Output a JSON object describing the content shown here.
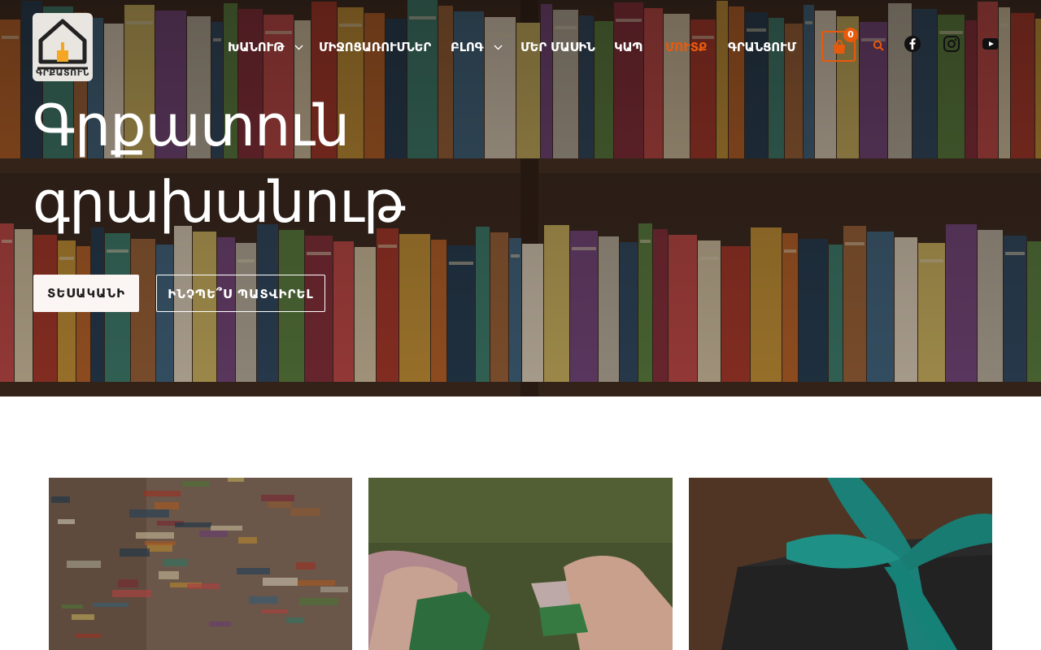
{
  "logo": {
    "text": "ԳՐՔԱՏՈՒՆ"
  },
  "nav": {
    "items": [
      {
        "label": "ԽԱՆՈՒԹ",
        "has_dropdown": true
      },
      {
        "label": "ՄԻՋՈՑԱՌՈՒՄՆԵՐ",
        "has_dropdown": false
      },
      {
        "label": "ԲԼՈԳ",
        "has_dropdown": true
      },
      {
        "label": "ՄԵՐ ՄԱՍԻՆ",
        "has_dropdown": false
      },
      {
        "label": "ԿԱՊ",
        "has_dropdown": false
      },
      {
        "label": "ՄՈՒՏՔ",
        "has_dropdown": false,
        "active": true
      },
      {
        "label": "ԳՐԱՆՑՈՒՄ",
        "has_dropdown": false
      }
    ]
  },
  "cart": {
    "count": "0",
    "icon": "shopping-bag-icon"
  },
  "search": {
    "icon": "search-icon"
  },
  "social": [
    {
      "name": "facebook",
      "icon": "facebook-icon"
    },
    {
      "name": "instagram",
      "icon": "instagram-icon"
    },
    {
      "name": "youtube",
      "icon": "youtube-icon"
    }
  ],
  "hero": {
    "title_line1": "Գրքատուն",
    "title_line2": "գրախանութ",
    "primary_button": "ՏԵՍԱԿԱՆԻ",
    "secondary_button": "ԻՆՉՊԵ՞Ս ՊԱՏՎԻՐԵԼ"
  },
  "cards": [
    {
      "image": "books-stack"
    },
    {
      "image": "puzzle-pieces"
    },
    {
      "image": "gift-box"
    }
  ],
  "colors": {
    "accent": "#e8590c",
    "hero_text": "#ffffff",
    "primary_button_bg": "#fbf6f4"
  }
}
